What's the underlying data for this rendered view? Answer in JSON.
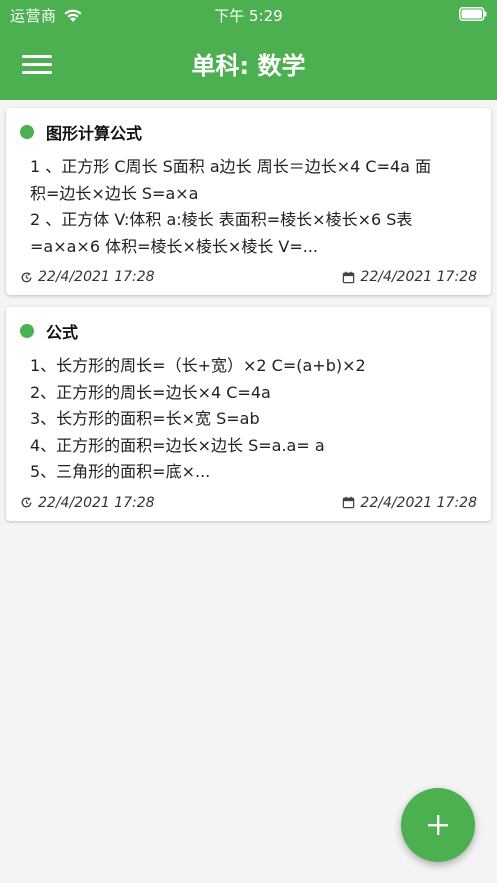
{
  "status_bar": {
    "carrier": "运营商",
    "time": "下午 5:29"
  },
  "header": {
    "title": "单科: 数学",
    "menu_icon": "hamburger-menu-icon"
  },
  "theme": {
    "primary": "#4caf50",
    "background": "#f4f4f4",
    "card": "#ffffff"
  },
  "notes": [
    {
      "title": "图形计算公式",
      "lines": [
        "1 、正方形 C周长 S面积 a边长 周长＝边长×4 C=4a 面",
        "积=边长×边长 S=a×a",
        "2 、正方体 V:体积 a:棱长 表面积=棱长×棱长×6 S表",
        "=a×a×6 体积=棱长×棱长×棱长 V=..."
      ],
      "modified": "22/4/2021 17:28",
      "created": "22/4/2021 17:28"
    },
    {
      "title": "公式",
      "lines": [
        "1、长方形的周长=（长+宽）×2 C=(a+b)×2",
        "2、正方形的周长=边长×4 C=4a",
        "3、长方形的面积=长×宽 S=ab",
        "4、正方形的面积=边长×边长 S=a.a= a",
        "5、三角形的面积=底×..."
      ],
      "modified": "22/4/2021 17:28",
      "created": "22/4/2021 17:28"
    }
  ],
  "fab": {
    "icon": "plus-icon"
  }
}
